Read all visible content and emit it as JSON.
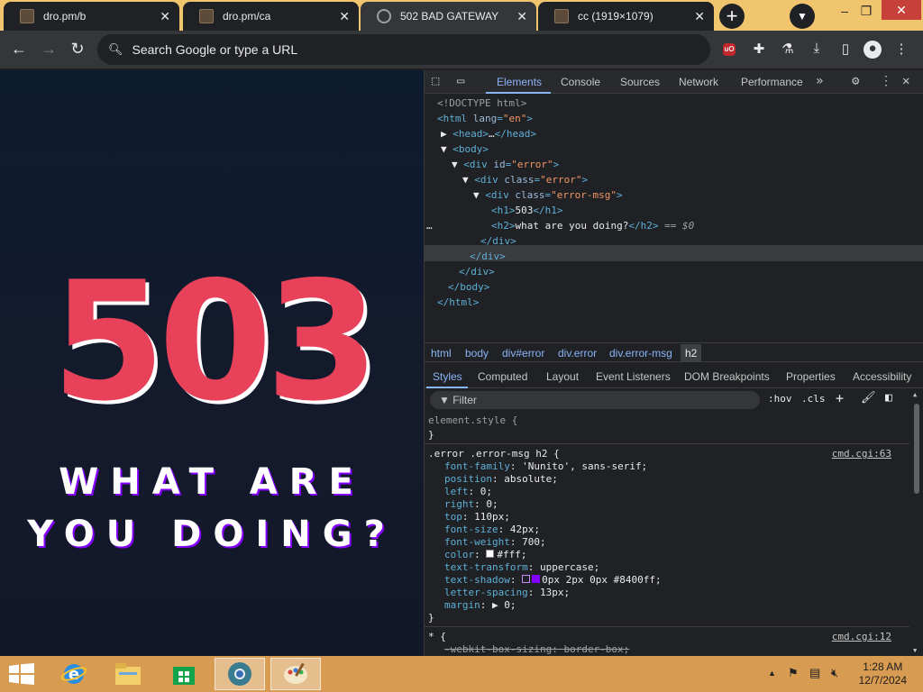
{
  "browser": {
    "tabs": [
      {
        "title": "dro.pm/b",
        "active": false
      },
      {
        "title": "dro.pm/ca",
        "active": false
      },
      {
        "title": "502 BAD GATEWAY",
        "active": true
      },
      {
        "title": "cc (1919×1079)",
        "active": false
      }
    ],
    "new_tab": "+",
    "omnibox_placeholder": "Search Google or type a URL",
    "ext_badge": "uO"
  },
  "page": {
    "code": "503",
    "message": "what are you doing?",
    "colors": {
      "code": "#e8415a",
      "shadow": "#8400ff",
      "text": "#ffffff"
    }
  },
  "devtools": {
    "tabs": [
      "Elements",
      "Console",
      "Sources",
      "Network",
      "Performance"
    ],
    "dom": {
      "doctype": "<!DOCTYPE html>",
      "html_open": "<html ",
      "html_attr": "lang",
      "html_val": "\"en\"",
      "html_close": ">",
      "head": "<head>",
      "head_close": "</head>",
      "body": "<body>",
      "div1_open": "<div ",
      "div1_attr": "id",
      "div1_val": "\"error\"",
      "div2_open": "<div ",
      "div2_attr": "class",
      "div2_val": "\"error\"",
      "div3_open": "<div ",
      "div3_attr": "class",
      "div3_val": "\"error-msg\"",
      "h1_open": "<h1>",
      "h1_text": "503",
      "h1_close": "</h1>",
      "h2_open": "<h2>",
      "h2_text": "what are you doing?",
      "h2_close": "</h2>",
      "h2_note": " == $0",
      "div_close": "</div>",
      "body_close": "</body>",
      "html_end": "</html>",
      "dots": "…"
    },
    "breadcrumbs": [
      "html",
      "body",
      "div#error",
      "div.error",
      "div.error-msg",
      "h2"
    ],
    "style_tabs": [
      "Styles",
      "Computed",
      "Layout",
      "Event Listeners",
      "DOM Breakpoints",
      "Properties",
      "Accessibility"
    ],
    "filter_placeholder": "Filter",
    "filter_tools": {
      "hov": ":hov",
      "cls": ".cls"
    },
    "element_style": "element.style {",
    "rule_selector": ".error .error-msg h2 {",
    "rule_source": "cmd.cgi:63",
    "rules": [
      {
        "prop": "font-family",
        "value": "'Nunito', sans-serif;"
      },
      {
        "prop": "position",
        "value": "absolute;"
      },
      {
        "prop": "left",
        "value": "0;"
      },
      {
        "prop": "right",
        "value": "0;"
      },
      {
        "prop": "top",
        "value": "110px;"
      },
      {
        "prop": "font-size",
        "value": "42px;"
      },
      {
        "prop": "font-weight",
        "value": "700;"
      },
      {
        "prop": "color",
        "value": "#fff;"
      },
      {
        "prop": "text-transform",
        "value": "uppercase;"
      },
      {
        "prop": "text-shadow",
        "value": "0px 2px 0px #8400ff;"
      },
      {
        "prop": "letter-spacing",
        "value": "13px;"
      },
      {
        "prop": "margin",
        "value": "▶ 0;"
      }
    ],
    "close_brace": "}",
    "universal_selector": "* {",
    "universal_source": "cmd.cgi:12",
    "universal_rule": "-webkit-box-sizing: border-box;"
  },
  "taskbar": {
    "time": "1:28 AM",
    "date": "12/7/2024"
  }
}
